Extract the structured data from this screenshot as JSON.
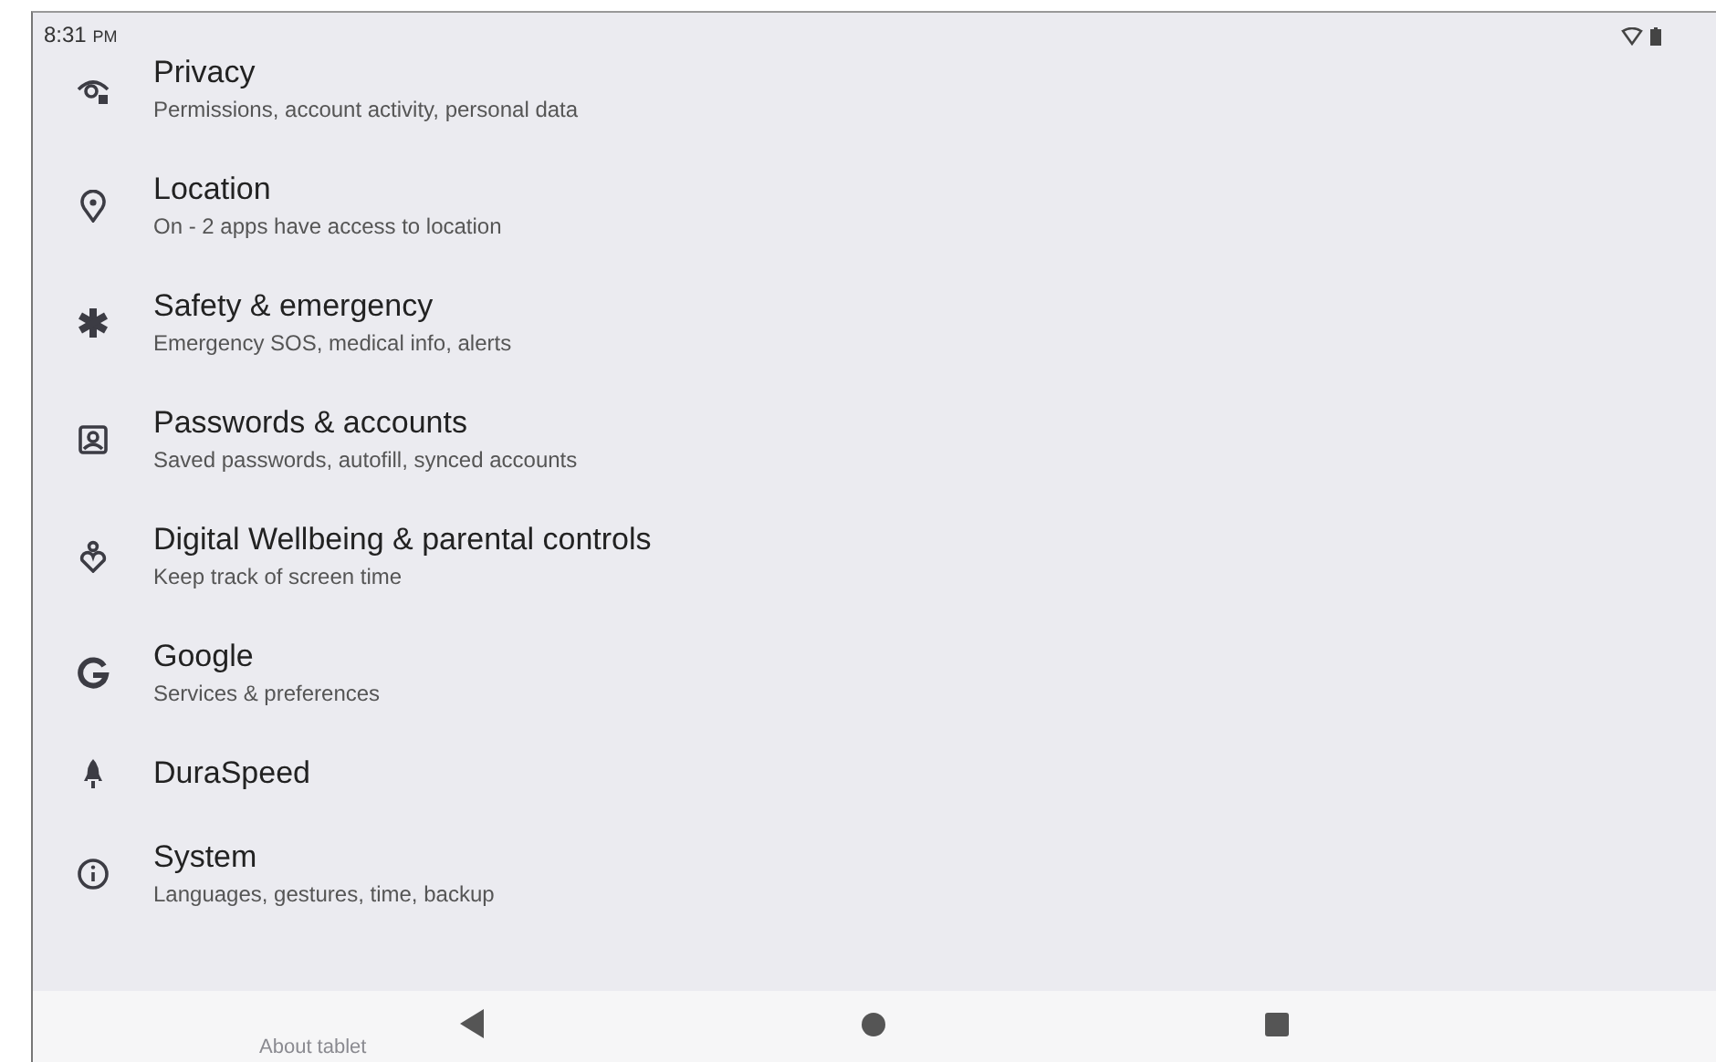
{
  "status_bar": {
    "time": "8:31",
    "meridiem": "PM"
  },
  "settings": [
    {
      "title": "Privacy",
      "subtitle": "Permissions, account activity, personal data"
    },
    {
      "title": "Location",
      "subtitle": "On - 2 apps have access to location"
    },
    {
      "title": "Safety & emergency",
      "subtitle": "Emergency SOS, medical info, alerts"
    },
    {
      "title": "Passwords & accounts",
      "subtitle": "Saved passwords, autofill, synced accounts"
    },
    {
      "title": "Digital Wellbeing & parental controls",
      "subtitle": "Keep track of screen time"
    },
    {
      "title": "Google",
      "subtitle": "Services & preferences"
    },
    {
      "title": "DuraSpeed"
    },
    {
      "title": "System",
      "subtitle": "Languages, gestures, time, backup"
    }
  ],
  "partly_hidden_item": {
    "title": "About tablet"
  }
}
